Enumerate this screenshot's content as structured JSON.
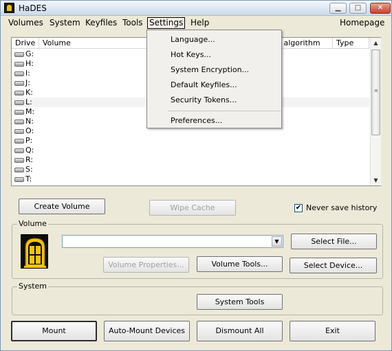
{
  "window": {
    "title": "HaDES",
    "min_glyph": "▁",
    "max_glyph": "□",
    "close_glyph": "✕"
  },
  "menubar": {
    "items": [
      "Volumes",
      "System",
      "Keyfiles",
      "Tools",
      "Settings",
      "Help"
    ],
    "homepage": "Homepage"
  },
  "settings_menu": {
    "items": [
      "Language...",
      "Hot Keys...",
      "System Encryption...",
      "Default Keyfiles...",
      "Security Tokens..."
    ],
    "bottom_item": "Preferences..."
  },
  "drive_list": {
    "columns": [
      "Drive",
      "Volume",
      "n algorithm",
      "Type"
    ],
    "drives": [
      "G:",
      "H:",
      "I:",
      "J:",
      "K:",
      "L:",
      "M:",
      "N:",
      "O:",
      "P:",
      "Q:",
      "R:",
      "S:",
      "T:"
    ],
    "selected_index": 5
  },
  "buttons": {
    "create_volume": "Create Volume",
    "wipe_cache": "Wipe Cache",
    "select_file": "Select File...",
    "volume_properties": "Volume Properties...",
    "volume_tools": "Volume Tools...",
    "select_device": "Select Device...",
    "system_tools": "System Tools",
    "mount": "Mount",
    "auto_mount": "Auto-Mount Devices",
    "dismount_all": "Dismount All",
    "exit": "Exit"
  },
  "never_save_history": {
    "label": "Never save history",
    "checked": true,
    "mark": "✔"
  },
  "groups": {
    "volume_title": "Volume",
    "system_title": "System"
  },
  "volume_path": {
    "value": ""
  },
  "icons": {
    "drive": "drive-icon",
    "logo": "hades-logo-icon",
    "scroll_up": "▲",
    "scroll_down": "▼",
    "combo_arrow": "▼",
    "grip": "≡"
  }
}
